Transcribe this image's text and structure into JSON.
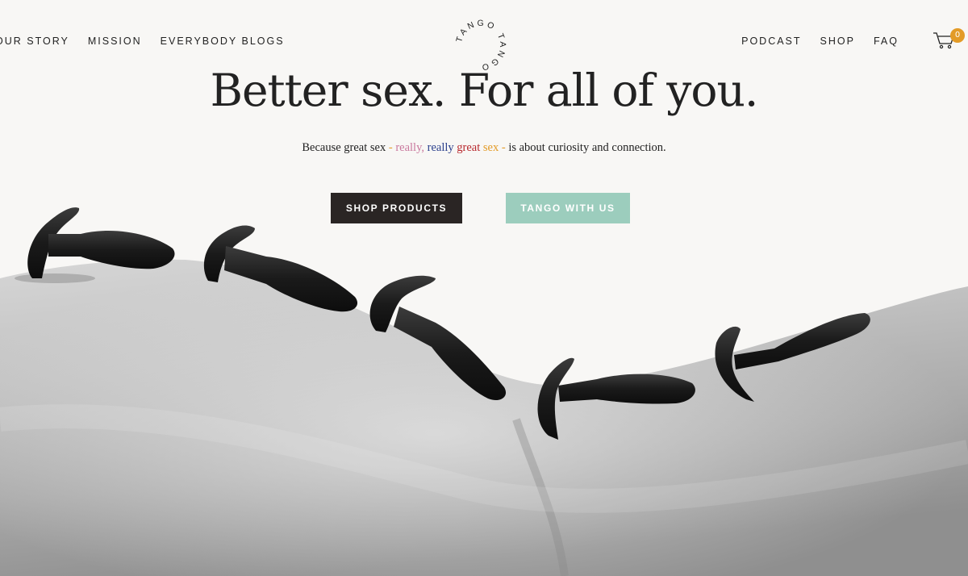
{
  "nav": {
    "left": [
      "OUR STORY",
      "MISSION",
      "EVERYBODY BLOGS"
    ],
    "right": [
      "PODCAST",
      "SHOP",
      "FAQ"
    ]
  },
  "logo": {
    "text": "TANGO TANGO"
  },
  "cart": {
    "count": "0"
  },
  "hero": {
    "title": "Better sex. For all of you.",
    "tagline": {
      "before": "Because great sex ",
      "dash1": "-",
      "word1": " really,",
      "word2": " really",
      "word3": " great",
      "word4": " sex",
      "dash2": " -",
      "after": " is about curiosity and connection."
    },
    "buttons": {
      "shop": "SHOP PRODUCTS",
      "tango": "TANGO WITH US"
    }
  },
  "colors": {
    "accent_orange": "#e39b27",
    "pink": "#c9789d",
    "blue": "#2a3f8c",
    "red": "#b8282e",
    "mint": "#9ccdbd",
    "dark": "#2a2524"
  }
}
